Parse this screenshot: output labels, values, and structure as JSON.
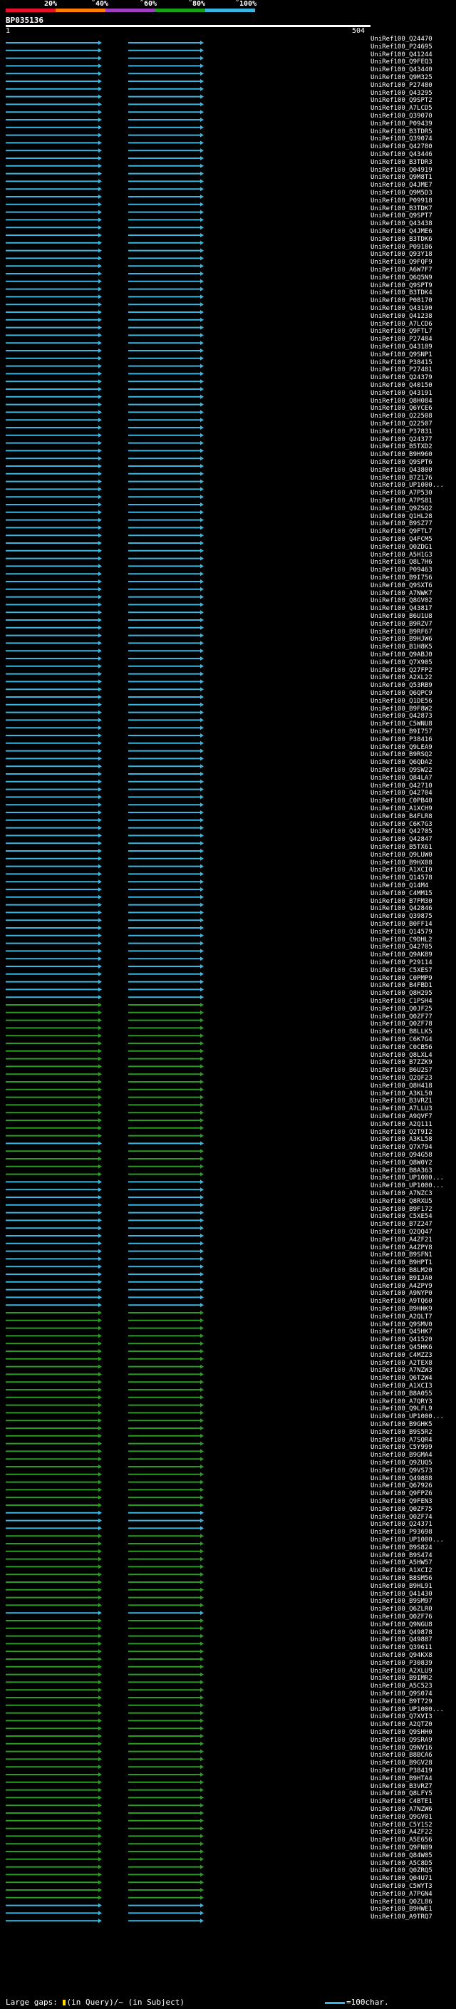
{
  "scale": {
    "ticks": [
      "20%",
      "˜40%",
      "˜60%",
      "˜80%",
      "˜100%"
    ],
    "colors": [
      "#e8102a",
      "#ff7f00",
      "#a040c0",
      "#1aa11a",
      "#3ab6e0"
    ]
  },
  "query": {
    "id": "BP035136",
    "start": "1",
    "end": "504"
  },
  "legend": {
    "large_gaps_text": "Large gaps: ",
    "in_query_text": "(in Query)/~ (in Subject)",
    "scale_text": "=100char."
  },
  "colors": {
    "cyan": "#3ab6e0",
    "green": "#2a9c22",
    "background": "#000000"
  },
  "hits": [
    {
      "id": "UniRef100_Q24470",
      "color": "cyan"
    },
    {
      "id": "UniRef100_P24695",
      "color": "cyan"
    },
    {
      "id": "UniRef100_Q41244",
      "color": "cyan"
    },
    {
      "id": "UniRef100_Q9FEQ3",
      "color": "cyan"
    },
    {
      "id": "UniRef100_Q43440",
      "color": "cyan"
    },
    {
      "id": "UniRef100_Q9M325",
      "color": "cyan"
    },
    {
      "id": "UniRef100_P27480",
      "color": "cyan"
    },
    {
      "id": "UniRef100_Q43295",
      "color": "cyan"
    },
    {
      "id": "UniRef100_Q9SPT2",
      "color": "cyan"
    },
    {
      "id": "UniRef100_A7LCD5",
      "color": "cyan"
    },
    {
      "id": "UniRef100_Q39070",
      "color": "cyan"
    },
    {
      "id": "UniRef100_P09439",
      "color": "cyan"
    },
    {
      "id": "UniRef100_B3TDR5",
      "color": "cyan"
    },
    {
      "id": "UniRef100_Q39074",
      "color": "cyan"
    },
    {
      "id": "UniRef100_Q42780",
      "color": "cyan"
    },
    {
      "id": "UniRef100_Q43446",
      "color": "cyan"
    },
    {
      "id": "UniRef100_B3TDR3",
      "color": "cyan"
    },
    {
      "id": "UniRef100_Q04919",
      "color": "cyan"
    },
    {
      "id": "UniRef100_Q9M8T1",
      "color": "cyan"
    },
    {
      "id": "UniRef100_Q4JME7",
      "color": "cyan"
    },
    {
      "id": "UniRef100_Q9M5D3",
      "color": "cyan"
    },
    {
      "id": "UniRef100_P09918",
      "color": "cyan"
    },
    {
      "id": "UniRef100_B3TDK7",
      "color": "cyan"
    },
    {
      "id": "UniRef100_Q9SPT7",
      "color": "cyan"
    },
    {
      "id": "UniRef100_Q43438",
      "color": "cyan"
    },
    {
      "id": "UniRef100_Q4JME6",
      "color": "cyan"
    },
    {
      "id": "UniRef100_B3TDK6",
      "color": "cyan"
    },
    {
      "id": "UniRef100_P09186",
      "color": "cyan"
    },
    {
      "id": "UniRef100_Q93Y18",
      "color": "cyan"
    },
    {
      "id": "UniRef100_Q9FQF9",
      "color": "cyan"
    },
    {
      "id": "UniRef100_A6W7F7",
      "color": "cyan"
    },
    {
      "id": "UniRef100_Q6Q5N9",
      "color": "cyan"
    },
    {
      "id": "UniRef100_Q9SPT9",
      "color": "cyan"
    },
    {
      "id": "UniRef100_B3TDK4",
      "color": "cyan"
    },
    {
      "id": "UniRef100_P08170",
      "color": "cyan"
    },
    {
      "id": "UniRef100_Q43190",
      "color": "cyan"
    },
    {
      "id": "UniRef100_Q41238",
      "color": "cyan"
    },
    {
      "id": "UniRef100_A7LCD6",
      "color": "cyan"
    },
    {
      "id": "UniRef100_Q9FTL7",
      "color": "cyan"
    },
    {
      "id": "UniRef100_P27484",
      "color": "cyan"
    },
    {
      "id": "UniRef100_Q43189",
      "color": "cyan"
    },
    {
      "id": "UniRef100_Q9SNP1",
      "color": "cyan"
    },
    {
      "id": "UniRef100_P38415",
      "color": "cyan"
    },
    {
      "id": "UniRef100_P27481",
      "color": "cyan"
    },
    {
      "id": "UniRef100_Q24379",
      "color": "cyan"
    },
    {
      "id": "UniRef100_Q40150",
      "color": "cyan"
    },
    {
      "id": "UniRef100_Q43191",
      "color": "cyan"
    },
    {
      "id": "UniRef100_Q8H084",
      "color": "cyan"
    },
    {
      "id": "UniRef100_Q6YCE6",
      "color": "cyan"
    },
    {
      "id": "UniRef100_Q22508",
      "color": "cyan"
    },
    {
      "id": "UniRef100_Q22507",
      "color": "cyan"
    },
    {
      "id": "UniRef100_P37831",
      "color": "cyan"
    },
    {
      "id": "UniRef100_Q24377",
      "color": "cyan"
    },
    {
      "id": "UniRef100_B5TXD2",
      "color": "cyan"
    },
    {
      "id": "UniRef100_B9H960",
      "color": "cyan"
    },
    {
      "id": "UniRef100_Q9SPT6",
      "color": "cyan"
    },
    {
      "id": "UniRef100_Q43800",
      "color": "cyan"
    },
    {
      "id": "UniRef100_B7Z176",
      "color": "cyan"
    },
    {
      "id": "UniRef100_UP1000...",
      "color": "cyan"
    },
    {
      "id": "UniRef100_A7P530",
      "color": "cyan"
    },
    {
      "id": "UniRef100_A7PS81",
      "color": "cyan"
    },
    {
      "id": "UniRef100_Q9ZSQ2",
      "color": "cyan"
    },
    {
      "id": "UniRef100_Q1HL28",
      "color": "cyan"
    },
    {
      "id": "UniRef100_B9SZ77",
      "color": "cyan"
    },
    {
      "id": "UniRef100_Q9FTL7",
      "color": "cyan"
    },
    {
      "id": "UniRef100_Q4FCM5",
      "color": "cyan"
    },
    {
      "id": "UniRef100_Q0ZDG1",
      "color": "cyan"
    },
    {
      "id": "UniRef100_A5H1G3",
      "color": "cyan"
    },
    {
      "id": "UniRef100_Q8L7H6",
      "color": "cyan"
    },
    {
      "id": "UniRef100_P09463",
      "color": "cyan"
    },
    {
      "id": "UniRef100_B9I756",
      "color": "cyan"
    },
    {
      "id": "UniRef100_Q9SXT6",
      "color": "cyan"
    },
    {
      "id": "UniRef100_A7NWK7",
      "color": "cyan"
    },
    {
      "id": "UniRef100_Q8GV02",
      "color": "cyan"
    },
    {
      "id": "UniRef100_Q43817",
      "color": "cyan"
    },
    {
      "id": "UniRef100_B6U1U8",
      "color": "cyan"
    },
    {
      "id": "UniRef100_B9RZV7",
      "color": "cyan"
    },
    {
      "id": "UniRef100_B9RF67",
      "color": "cyan"
    },
    {
      "id": "UniRef100_B9HJW6",
      "color": "cyan"
    },
    {
      "id": "UniRef100_B1H8K5",
      "color": "cyan"
    },
    {
      "id": "UniRef100_Q9ABJ0",
      "color": "cyan"
    },
    {
      "id": "UniRef100_Q7X905",
      "color": "cyan"
    },
    {
      "id": "UniRef100_Q27FP2",
      "color": "cyan"
    },
    {
      "id": "UniRef100_A2XL22",
      "color": "cyan"
    },
    {
      "id": "UniRef100_Q53RB9",
      "color": "cyan"
    },
    {
      "id": "UniRef100_Q6QPC9",
      "color": "cyan"
    },
    {
      "id": "UniRef100_Q1DE56",
      "color": "cyan"
    },
    {
      "id": "UniRef100_B9F8W2",
      "color": "cyan"
    },
    {
      "id": "UniRef100_Q42873",
      "color": "cyan"
    },
    {
      "id": "UniRef100_C5WNU8",
      "color": "cyan"
    },
    {
      "id": "UniRef100_B9I757",
      "color": "cyan"
    },
    {
      "id": "UniRef100_P38416",
      "color": "cyan"
    },
    {
      "id": "UniRef100_Q9LEA9",
      "color": "cyan"
    },
    {
      "id": "UniRef100_B9RSQ2",
      "color": "cyan"
    },
    {
      "id": "UniRef100_Q6QDA2",
      "color": "cyan"
    },
    {
      "id": "UniRef100_Q9SW22",
      "color": "cyan"
    },
    {
      "id": "UniRef100_Q84LA7",
      "color": "cyan"
    },
    {
      "id": "UniRef100_Q42710",
      "color": "cyan"
    },
    {
      "id": "UniRef100_Q42704",
      "color": "cyan"
    },
    {
      "id": "UniRef100_C0PB40",
      "color": "cyan"
    },
    {
      "id": "UniRef100_A1XCH9",
      "color": "cyan"
    },
    {
      "id": "UniRef100_B4FLR8",
      "color": "cyan"
    },
    {
      "id": "UniRef100_C6K7G3",
      "color": "cyan"
    },
    {
      "id": "UniRef100_Q42705",
      "color": "cyan"
    },
    {
      "id": "UniRef100_Q42847",
      "color": "cyan"
    },
    {
      "id": "UniRef100_B5TX61",
      "color": "cyan"
    },
    {
      "id": "UniRef100_Q9LUW0",
      "color": "cyan"
    },
    {
      "id": "UniRef100_B9HX08",
      "color": "cyan"
    },
    {
      "id": "UniRef100_A1XCI0",
      "color": "cyan"
    },
    {
      "id": "UniRef100_Q14578",
      "color": "cyan"
    },
    {
      "id": "UniRef100_Q14M4",
      "color": "cyan"
    },
    {
      "id": "UniRef100_C4MM15",
      "color": "cyan"
    },
    {
      "id": "UniRef100_B7FM30",
      "color": "cyan"
    },
    {
      "id": "UniRef100_Q42846",
      "color": "cyan"
    },
    {
      "id": "UniRef100_Q39875",
      "color": "cyan"
    },
    {
      "id": "UniRef100_B0FF14",
      "color": "cyan"
    },
    {
      "id": "UniRef100_Q14579",
      "color": "cyan"
    },
    {
      "id": "UniRef100_C9DHL2",
      "color": "cyan"
    },
    {
      "id": "UniRef100_Q42705",
      "color": "cyan"
    },
    {
      "id": "UniRef100_Q9AK89",
      "color": "cyan"
    },
    {
      "id": "UniRef100_P29114",
      "color": "cyan"
    },
    {
      "id": "UniRef100_C5XES7",
      "color": "cyan"
    },
    {
      "id": "UniRef100_C0PMP9",
      "color": "cyan"
    },
    {
      "id": "UniRef100_B4FBD1",
      "color": "cyan"
    },
    {
      "id": "UniRef100_Q8H295",
      "color": "cyan"
    },
    {
      "id": "UniRef100_C1PSH4",
      "color": "green"
    },
    {
      "id": "UniRef100_Q0JF25",
      "color": "green"
    },
    {
      "id": "UniRef100_Q0ZF77",
      "color": "green"
    },
    {
      "id": "UniRef100_Q0ZF78",
      "color": "green"
    },
    {
      "id": "UniRef100_B8LLK5",
      "color": "green"
    },
    {
      "id": "UniRef100_C6K7G4",
      "color": "green"
    },
    {
      "id": "UniRef100_C0CB56",
      "color": "green"
    },
    {
      "id": "UniRef100_Q8LXL4",
      "color": "green"
    },
    {
      "id": "UniRef100_B7ZZK9",
      "color": "green"
    },
    {
      "id": "UniRef100_B6U2S7",
      "color": "green"
    },
    {
      "id": "UniRef100_Q2QF23",
      "color": "green"
    },
    {
      "id": "UniRef100_Q8H418",
      "color": "green"
    },
    {
      "id": "UniRef100_A3KL50",
      "color": "green"
    },
    {
      "id": "UniRef100_B3VRZ1",
      "color": "green"
    },
    {
      "id": "UniRef100_A7LLU3",
      "color": "green"
    },
    {
      "id": "UniRef100_A9QVF7",
      "color": "green"
    },
    {
      "id": "UniRef100_A2Q111",
      "color": "green"
    },
    {
      "id": "UniRef100_Q2T9I2",
      "color": "green"
    },
    {
      "id": "UniRef100_A3KL58",
      "color": "cyan"
    },
    {
      "id": "UniRef100_Q7X794",
      "color": "green"
    },
    {
      "id": "UniRef100_Q94G58",
      "color": "green"
    },
    {
      "id": "UniRef100_Q8W0Y2",
      "color": "green"
    },
    {
      "id": "UniRef100_B8A363",
      "color": "green"
    },
    {
      "id": "UniRef100_UP1000...",
      "color": "cyan"
    },
    {
      "id": "UniRef100_UP1000...",
      "color": "cyan"
    },
    {
      "id": "UniRef100_A7NZC3",
      "color": "cyan"
    },
    {
      "id": "UniRef100_Q8RXU5",
      "color": "cyan"
    },
    {
      "id": "UniRef100_B9F172",
      "color": "cyan"
    },
    {
      "id": "UniRef100_C5XE54",
      "color": "cyan"
    },
    {
      "id": "UniRef100_B7Z247",
      "color": "cyan"
    },
    {
      "id": "UniRef100_Q2QQ47",
      "color": "cyan"
    },
    {
      "id": "UniRef100_A4ZF21",
      "color": "cyan"
    },
    {
      "id": "UniRef100_A4ZPY8",
      "color": "cyan"
    },
    {
      "id": "UniRef100_B9SFN1",
      "color": "cyan"
    },
    {
      "id": "UniRef100_B9HPT1",
      "color": "cyan"
    },
    {
      "id": "UniRef100_B8LM20",
      "color": "cyan"
    },
    {
      "id": "UniRef100_B9IJA0",
      "color": "cyan"
    },
    {
      "id": "UniRef100_A4ZPY9",
      "color": "cyan"
    },
    {
      "id": "UniRef100_A9NYP0",
      "color": "cyan"
    },
    {
      "id": "UniRef100_A9TQ60",
      "color": "cyan"
    },
    {
      "id": "UniRef100_B9HHK9",
      "color": "green"
    },
    {
      "id": "UniRef100_A2QLT7",
      "color": "green"
    },
    {
      "id": "UniRef100_Q9SMV0",
      "color": "green"
    },
    {
      "id": "UniRef100_Q45HK7",
      "color": "green"
    },
    {
      "id": "UniRef100_Q41520",
      "color": "green"
    },
    {
      "id": "UniRef100_Q45HK6",
      "color": "green"
    },
    {
      "id": "UniRef100_C4MZZ3",
      "color": "green"
    },
    {
      "id": "UniRef100_A2TEX8",
      "color": "green"
    },
    {
      "id": "UniRef100_A7NZW3",
      "color": "green"
    },
    {
      "id": "UniRef100_Q6T2W4",
      "color": "green"
    },
    {
      "id": "UniRef100_A1XCI3",
      "color": "green"
    },
    {
      "id": "UniRef100_B8A055",
      "color": "green"
    },
    {
      "id": "UniRef100_A7QRY3",
      "color": "green"
    },
    {
      "id": "UniRef100_Q9LFL9",
      "color": "green"
    },
    {
      "id": "UniRef100_UP1000...",
      "color": "green"
    },
    {
      "id": "UniRef100_B9GHK5",
      "color": "green"
    },
    {
      "id": "UniRef100_B9S5R2",
      "color": "green"
    },
    {
      "id": "UniRef100_A7SQR4",
      "color": "green"
    },
    {
      "id": "UniRef100_C5Y999",
      "color": "green"
    },
    {
      "id": "UniRef100_B9GMA4",
      "color": "green"
    },
    {
      "id": "UniRef100_Q9ZUQ5",
      "color": "green"
    },
    {
      "id": "UniRef100_Q9VS73",
      "color": "green"
    },
    {
      "id": "UniRef100_Q49888",
      "color": "green"
    },
    {
      "id": "UniRef100_Q67926",
      "color": "green"
    },
    {
      "id": "UniRef100_Q9FPZ6",
      "color": "green"
    },
    {
      "id": "UniRef100_Q9FEN3",
      "color": "green"
    },
    {
      "id": "UniRef100_Q0ZF75",
      "color": "cyan"
    },
    {
      "id": "UniRef100_Q0ZF74",
      "color": "cyan"
    },
    {
      "id": "UniRef100_Q24371",
      "color": "cyan"
    },
    {
      "id": "UniRef100_P93698",
      "color": "green"
    },
    {
      "id": "UniRef100_UP1000...",
      "color": "green"
    },
    {
      "id": "UniRef100_B9S824",
      "color": "green"
    },
    {
      "id": "UniRef100_B9S474",
      "color": "green"
    },
    {
      "id": "UniRef100_A5HW57",
      "color": "green"
    },
    {
      "id": "UniRef100_A1XCI2",
      "color": "green"
    },
    {
      "id": "UniRef100_B8SM56",
      "color": "green"
    },
    {
      "id": "UniRef100_B9HL91",
      "color": "green"
    },
    {
      "id": "UniRef100_Q41430",
      "color": "green"
    },
    {
      "id": "UniRef100_B9SM97",
      "color": "green"
    },
    {
      "id": "UniRef100_Q6ZLR0",
      "color": "cyan"
    },
    {
      "id": "UniRef100_Q0ZF76",
      "color": "green"
    },
    {
      "id": "UniRef100_Q9NGU8",
      "color": "green"
    },
    {
      "id": "UniRef100_Q49878",
      "color": "green"
    },
    {
      "id": "UniRef100_Q49887",
      "color": "green"
    },
    {
      "id": "UniRef100_Q39611",
      "color": "green"
    },
    {
      "id": "UniRef100_Q94KX8",
      "color": "green"
    },
    {
      "id": "UniRef100_P30839",
      "color": "green"
    },
    {
      "id": "UniRef100_A2XLU9",
      "color": "green"
    },
    {
      "id": "UniRef100_B9IMR2",
      "color": "green"
    },
    {
      "id": "UniRef100_A5C523",
      "color": "green"
    },
    {
      "id": "UniRef100_Q9S074",
      "color": "green"
    },
    {
      "id": "UniRef100_B9T729",
      "color": "green"
    },
    {
      "id": "UniRef100_UP1000...",
      "color": "green"
    },
    {
      "id": "UniRef100_Q7XVI3",
      "color": "green"
    },
    {
      "id": "UniRef100_A2QTZ0",
      "color": "green"
    },
    {
      "id": "UniRef100_Q9SHH0",
      "color": "green"
    },
    {
      "id": "UniRef100_Q9SRA9",
      "color": "green"
    },
    {
      "id": "UniRef100_Q9NV16",
      "color": "green"
    },
    {
      "id": "UniRef100_B8BCA6",
      "color": "green"
    },
    {
      "id": "UniRef100_B9GV28",
      "color": "green"
    },
    {
      "id": "UniRef100_P38419",
      "color": "green"
    },
    {
      "id": "UniRef100_B9HTA4",
      "color": "green"
    },
    {
      "id": "UniRef100_B3VRZ7",
      "color": "green"
    },
    {
      "id": "UniRef100_Q8LFY5",
      "color": "green"
    },
    {
      "id": "UniRef100_C4BTE1",
      "color": "green"
    },
    {
      "id": "UniRef100_A7NZW6",
      "color": "green"
    },
    {
      "id": "UniRef100_Q9GV01",
      "color": "green"
    },
    {
      "id": "UniRef100_C5Y1S2",
      "color": "green"
    },
    {
      "id": "UniRef100_A4ZF22",
      "color": "green"
    },
    {
      "id": "UniRef100_A5E656",
      "color": "green"
    },
    {
      "id": "UniRef100_Q9FN89",
      "color": "green"
    },
    {
      "id": "UniRef100_Q84W05",
      "color": "green"
    },
    {
      "id": "UniRef100_A5C8D5",
      "color": "green"
    },
    {
      "id": "UniRef100_Q0ZRQ5",
      "color": "green"
    },
    {
      "id": "UniRef100_Q04U71",
      "color": "green"
    },
    {
      "id": "UniRef100_C5WYT3",
      "color": "green"
    },
    {
      "id": "UniRef100_A7PGN4",
      "color": "green"
    },
    {
      "id": "UniRef100_Q0ZL86",
      "color": "cyan"
    },
    {
      "id": "UniRef100_B9HWE1",
      "color": "cyan"
    },
    {
      "id": "UniRef100_A9TRQ7",
      "color": "cyan"
    }
  ]
}
